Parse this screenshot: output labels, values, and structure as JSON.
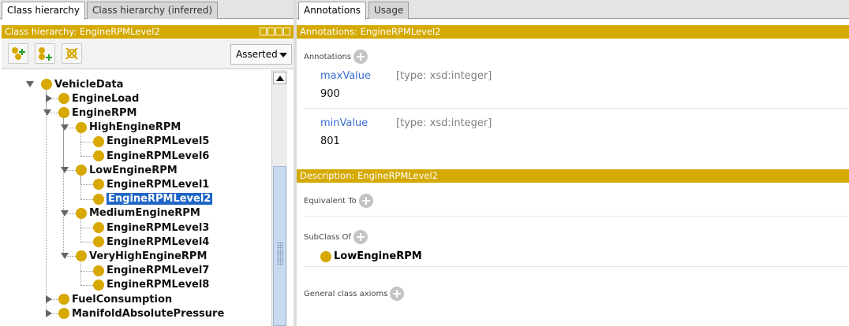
{
  "left_tabs": [
    "Class hierarchy",
    "Class hierarchy (inferred)"
  ],
  "right_tabs": [
    "Annotations",
    "Usage"
  ],
  "hierarchy": {
    "title": "Class hierarchy: EngineRPMLevel2",
    "mode": "Asserted",
    "tree": [
      {
        "label": "VehicleData",
        "expander": "open"
      },
      {
        "label": "EngineLoad",
        "expander": "closed"
      },
      {
        "label": "EngineRPM",
        "expander": "open"
      },
      {
        "label": "HighEngineRPM",
        "expander": "open"
      },
      {
        "label": "EngineRPMLevel5",
        "expander": "none"
      },
      {
        "label": "EngineRPMLevel6",
        "expander": "none"
      },
      {
        "label": "LowEngineRPM",
        "expander": "open"
      },
      {
        "label": "EngineRPMLevel1",
        "expander": "none"
      },
      {
        "label": "EngineRPMLevel2",
        "expander": "none",
        "selected": true
      },
      {
        "label": "MediumEngineRPM",
        "expander": "open"
      },
      {
        "label": "EngineRPMLevel3",
        "expander": "none"
      },
      {
        "label": "EngineRPMLevel4",
        "expander": "none"
      },
      {
        "label": "VeryHighEngineRPM",
        "expander": "open"
      },
      {
        "label": "EngineRPMLevel7",
        "expander": "none"
      },
      {
        "label": "EngineRPMLevel8",
        "expander": "none"
      },
      {
        "label": "FuelConsumption",
        "expander": "closed"
      },
      {
        "label": "ManifoldAbsolutePressure",
        "expander": "closed"
      }
    ]
  },
  "annotations": {
    "title": "Annotations: EngineRPMLevel2",
    "section_label": "Annotations",
    "items": [
      {
        "property": "maxValue",
        "type": "[type: xsd:integer]",
        "value": "900"
      },
      {
        "property": "minValue",
        "type": "[type: xsd:integer]",
        "value": "801"
      }
    ]
  },
  "description": {
    "title": "Description: EngineRPMLevel2",
    "equivalent_label": "Equivalent To",
    "subclass_label": "SubClass Of",
    "subclass_value": "LowEngineRPM",
    "general_label": "General class axioms"
  },
  "colors": {
    "title_bar": "#d4a900",
    "class_dot": "#d7a800",
    "selection": "#1f66c6",
    "property_link": "#3a6fd1"
  }
}
